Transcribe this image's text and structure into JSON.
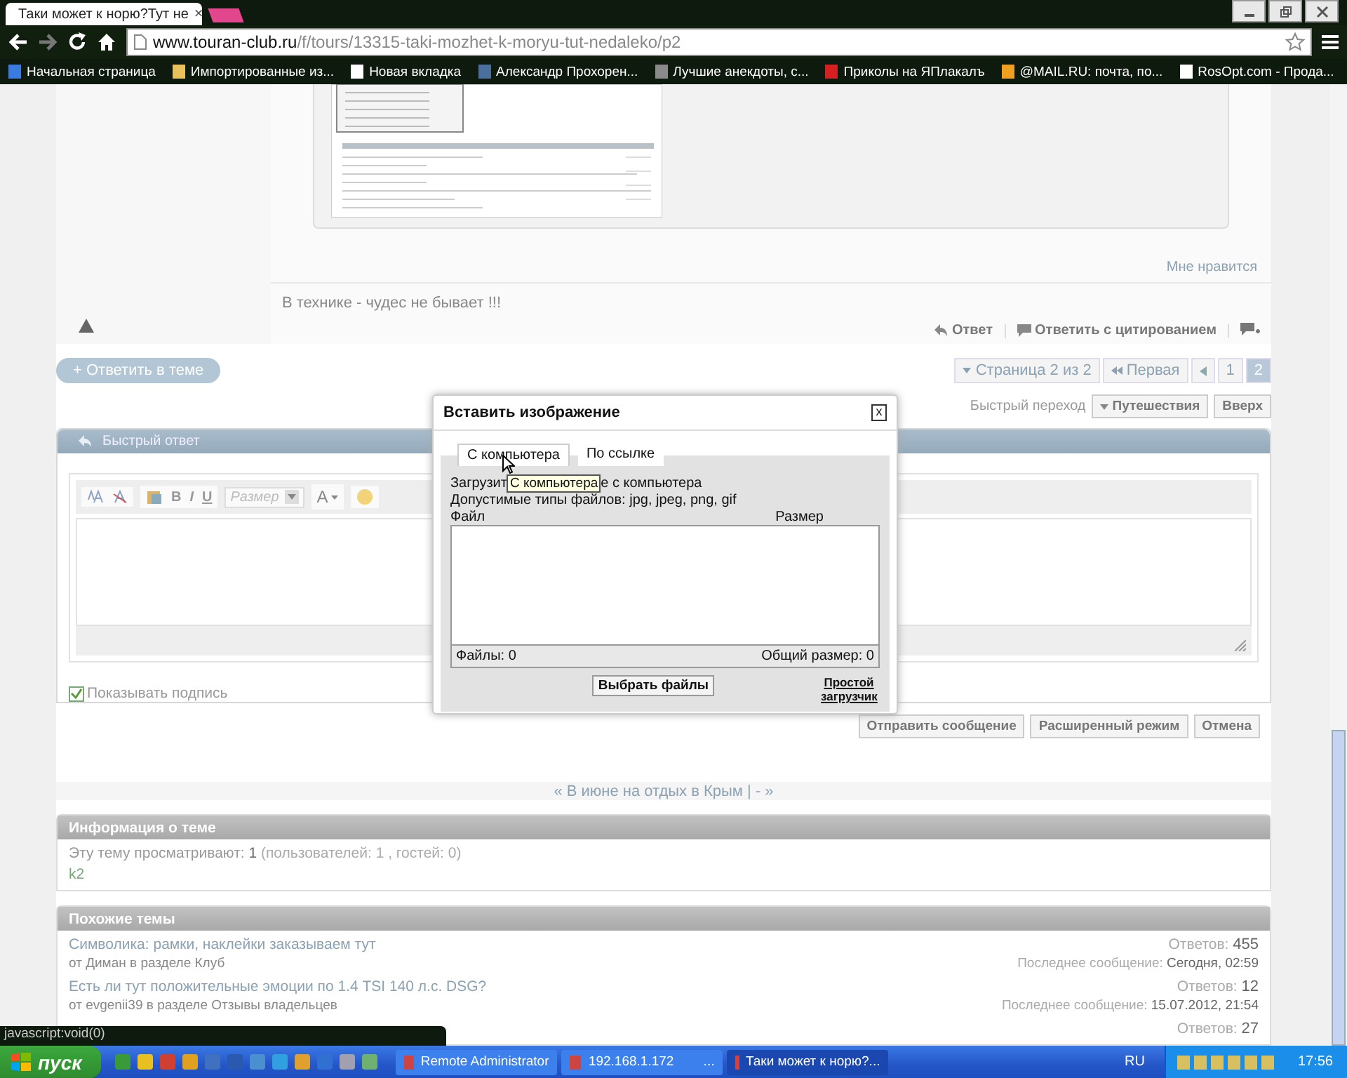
{
  "browser": {
    "tab_title": "Таки может к норю?Тут не",
    "tab_close": "×",
    "url_domain": "www.touran-club.ru",
    "url_path": "/f/tours/13315-taki-mozhet-k-moryu-tut-nedaleko/p2"
  },
  "bookmarks": [
    {
      "label": "Начальная страница",
      "kind": "google"
    },
    {
      "label": "Импортированные из...",
      "kind": "folder"
    },
    {
      "label": "Новая вкладка",
      "kind": "page"
    },
    {
      "label": "Александр Прохорен...",
      "kind": "vk"
    },
    {
      "label": "Лучшие анекдоты, с...",
      "kind": "star"
    },
    {
      "label": "Приколы на ЯПлакалъ",
      "kind": "red"
    },
    {
      "label": "@MAIL.RU: почта, по...",
      "kind": "mail"
    },
    {
      "label": "RosOpt.com - Прода...",
      "kind": "page"
    }
  ],
  "post": {
    "like": "Мне нравится",
    "signature": "В технике - чудес не бывает !!!",
    "actions": [
      "Ответ",
      "Ответить с цитированием"
    ]
  },
  "reply_button": "+ Ответить в теме",
  "pagination": {
    "page_label": "Страница 2 из 2",
    "first": "Первая",
    "pages": [
      {
        "label": "1",
        "selected": false
      },
      {
        "label": "2",
        "selected": true
      }
    ]
  },
  "quick_nav": {
    "label": "Быстрый переход",
    "forum": "Путешествия",
    "top": "Вверх"
  },
  "quick_reply": {
    "title": "Быстрый ответ",
    "format_buttons": [
      "B",
      "I",
      "U"
    ],
    "size_placeholder": "Размер",
    "font_color": "A",
    "show_signature": {
      "label": "Показывать подпись",
      "checked": true
    },
    "buttons": [
      "Отправить сообщение",
      "Расширенный режим",
      "Отмена"
    ]
  },
  "thread_nav": "« В июне на отдых в Крым | - »",
  "topic_info": {
    "title": "Информация о теме",
    "viewers_label": "Эту тему просматривают:",
    "viewers_count": "1",
    "viewers_detail": "(пользователей: 1 , гостей: 0)",
    "users": [
      "k2"
    ]
  },
  "similar": {
    "title": "Похожие темы",
    "rows": [
      {
        "title": "Символика: рамки, наклейки заказываем тут",
        "author": "от Диман в разделе Клуб",
        "replies_label": "Ответов:",
        "replies": "455",
        "last_label": "Последнее сообщение:",
        "last": "Сегодня, 02:59"
      },
      {
        "title": "Есть ли тут положительные эмоции по 1.4 TSI 140 л.с. DSG?",
        "author": "от evgenii39 в разделе Отзывы владельцев",
        "replies_label": "Ответов:",
        "replies": "12",
        "last_label": "Последнее сообщение:",
        "last": "15.07.2012, 21:54"
      },
      {
        "replies_label": "Ответов:",
        "replies": "27"
      }
    ]
  },
  "dialog": {
    "title": "Вставить изображение",
    "close": "x",
    "tabs": [
      {
        "label": "С компьютера",
        "selected": true
      },
      {
        "label": "По ссылке",
        "selected": false
      }
    ],
    "tooltip": "С компьютера",
    "hint_start": "Загрузит",
    "hint_end": "е с компьютера",
    "types": "Допустимые типы файлов: jpg, jpeg, png, gif",
    "col_file": "Файл",
    "col_size": "Размер",
    "files": "Файлы: 0",
    "total": "Общий размер: 0",
    "choose": "Выбрать файлы",
    "simple": "Простой загрузчик"
  },
  "status_url": "javascript:void(0)",
  "taskbar": {
    "start": "пуск",
    "tasks": [
      {
        "label": "Remote Administrator",
        "selected": false
      },
      {
        "label": "192.168.1.172        ...",
        "selected": false
      },
      {
        "label": "Таки может к норю?...",
        "selected": true
      }
    ],
    "lang": "RU",
    "clock": "17:56"
  }
}
